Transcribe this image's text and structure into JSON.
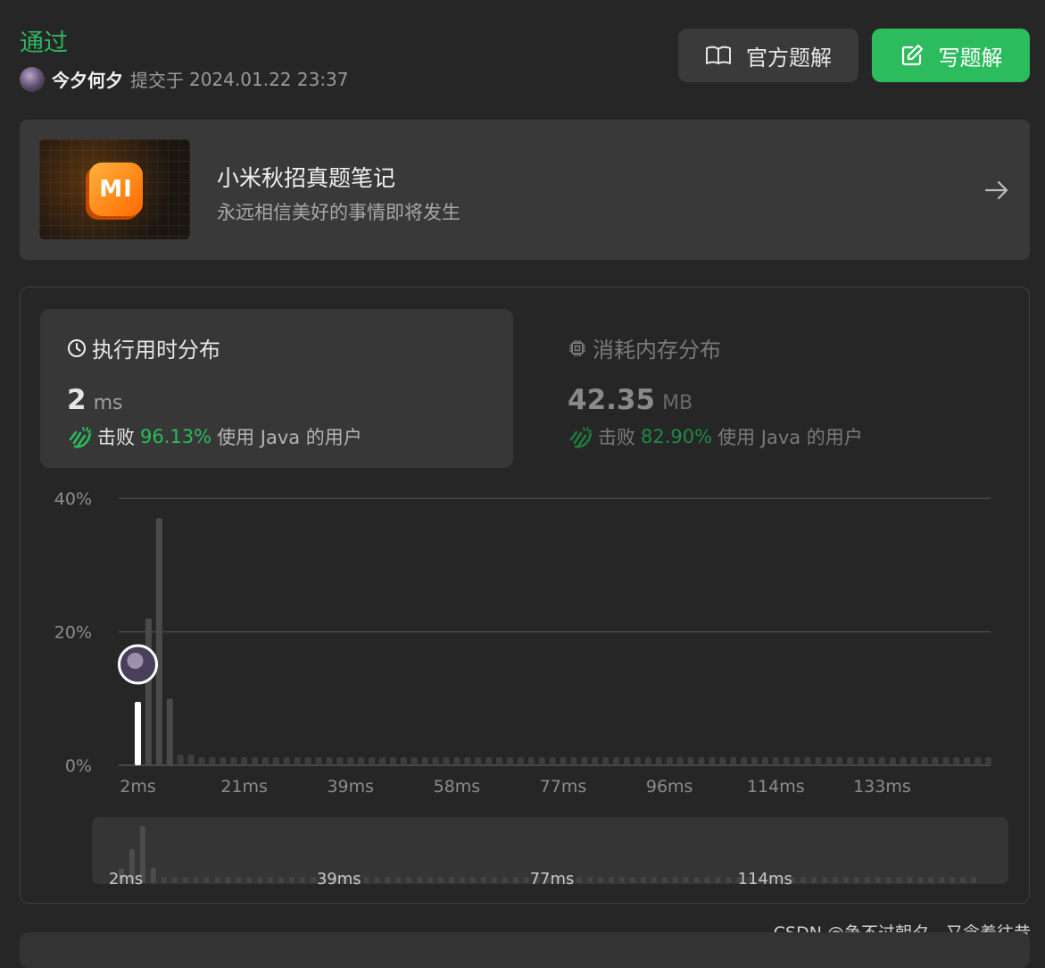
{
  "header": {
    "status": "通过",
    "user": "今夕何夕",
    "submitted_label": "提交于",
    "submitted_time": "2024.01.22 23:37",
    "official_solution_label": "官方题解",
    "write_solution_label": "写题解"
  },
  "banner": {
    "logo_text": "MI",
    "title": "小米秋招真题笔记",
    "subtitle": "永远相信美好的事情即将发生"
  },
  "stats": {
    "time": {
      "title": "执行用时分布",
      "value": "2",
      "unit": "ms",
      "beats_label": "击败",
      "beats_pct": "96.13%",
      "beats_suffix": "使用 Java 的用户"
    },
    "memory": {
      "title": "消耗内存分布",
      "value": "42.35",
      "unit": "MB",
      "beats_label": "击败",
      "beats_pct": "82.90%",
      "beats_suffix": "使用 Java 的用户"
    }
  },
  "chart_data": {
    "type": "bar",
    "title": "",
    "xlabel": "",
    "ylabel": "",
    "ylim": [
      0,
      40
    ],
    "y_ticks": [
      "0%",
      "20%",
      "40%"
    ],
    "x_ticks": [
      "2ms",
      "21ms",
      "39ms",
      "58ms",
      "77ms",
      "96ms",
      "114ms",
      "133ms"
    ],
    "values": [
      9.5,
      22,
      37,
      10,
      1.6,
      1.6,
      1.2,
      1.2,
      1.2,
      1.2,
      1.2,
      1.2,
      1.2,
      1.2,
      1.2,
      1.2,
      1.2,
      1.2,
      1.2,
      1.2,
      1.2,
      1.2,
      1.2,
      1.2,
      1.2,
      1.2,
      1.2,
      1.2,
      1.2,
      1.2,
      1.2,
      1.2,
      1.2,
      1.2,
      1.2,
      1.2,
      1.2,
      1.2,
      1.2,
      1.2,
      1.2,
      1.2,
      1.2,
      1.2,
      1.2,
      1.2,
      1.2,
      1.2,
      1.2,
      1.2,
      1.2,
      1.2,
      1.2,
      1.2,
      1.2,
      1.2,
      1.2,
      1.2,
      1.2,
      1.2,
      1.2,
      1.2,
      1.2,
      1.2,
      1.2,
      1.2,
      1.2,
      1.2,
      1.2,
      1.2,
      1.2,
      1.2,
      1.2,
      1.2,
      1.2,
      1.2,
      1.2,
      1.2,
      1.2,
      1.2,
      1.2
    ],
    "highlight_index": 0,
    "overview_ticks": [
      "2ms",
      "39ms",
      "77ms",
      "114ms"
    ]
  },
  "watermark": "CSDN @争不过朝夕，又念着往昔",
  "colors": {
    "accent": "#2cbb5d",
    "background": "#262626",
    "card": "#393939"
  }
}
